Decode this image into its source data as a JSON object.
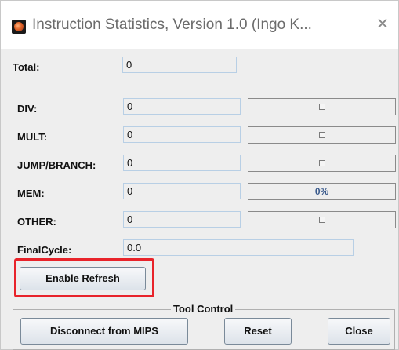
{
  "window": {
    "title": "Instruction Statistics, Version 1.0 (Ingo K...",
    "close_symbol": "✕",
    "icon": "app-icon"
  },
  "total": {
    "label": "Total:",
    "value": "0"
  },
  "rows": [
    {
      "label": "DIV:",
      "value": "0",
      "percent": null,
      "bar_fill": 0
    },
    {
      "label": "MULT:",
      "value": "0",
      "percent": null,
      "bar_fill": 0
    },
    {
      "label": "JUMP/BRANCH:",
      "value": "0",
      "percent": null,
      "bar_fill": 0
    },
    {
      "label": "MEM:",
      "value": "0",
      "percent": "0%",
      "bar_fill": 0
    },
    {
      "label": "OTHER:",
      "value": "0",
      "percent": null,
      "bar_fill": 0
    }
  ],
  "final_cycle": {
    "label": "FinalCycle:",
    "value": "0.0"
  },
  "buttons": {
    "enable_refresh": "Enable Refresh",
    "disconnect": "Disconnect from MIPS",
    "reset": "Reset",
    "close": "Close"
  },
  "tool_control": {
    "title": "Tool Control"
  },
  "colors": {
    "highlight": "#e8232a",
    "field_border": "#b8cfe5",
    "percent_text": "#3a5a8c"
  }
}
